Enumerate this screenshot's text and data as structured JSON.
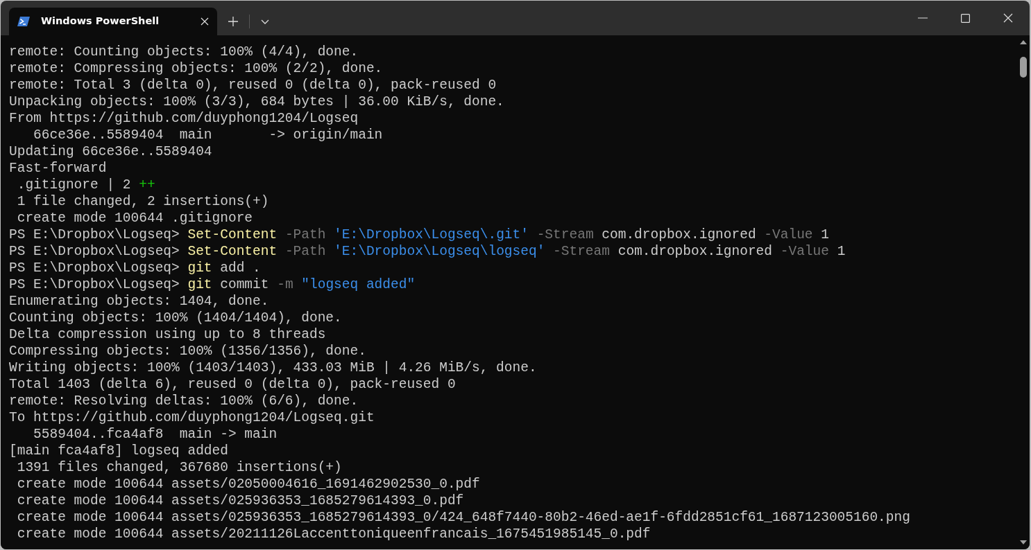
{
  "tabs": [
    {
      "label": "Windows PowerShell",
      "selected": true
    }
  ],
  "terminal": {
    "lines": [
      {
        "segments": [
          {
            "kind": "output",
            "text": "remote: Counting objects: 100% (4/4), done."
          }
        ]
      },
      {
        "segments": [
          {
            "kind": "output",
            "text": "remote: Compressing objects: 100% (2/2), done."
          }
        ]
      },
      {
        "segments": [
          {
            "kind": "output",
            "text": "remote: Total 3 (delta 0), reused 0 (delta 0), pack-reused 0"
          }
        ]
      },
      {
        "segments": [
          {
            "kind": "output",
            "text": "Unpacking objects: 100% (3/3), 684 bytes | 36.00 KiB/s, done."
          }
        ]
      },
      {
        "segments": [
          {
            "kind": "output",
            "text": "From https://github.com/duyphong1204/Logseq"
          }
        ]
      },
      {
        "segments": [
          {
            "kind": "output",
            "text": "   66ce36e..5589404  main       -> origin/main"
          }
        ]
      },
      {
        "segments": [
          {
            "kind": "output",
            "text": "Updating 66ce36e..5589404"
          }
        ]
      },
      {
        "segments": [
          {
            "kind": "output",
            "text": "Fast-forward"
          }
        ]
      },
      {
        "segments": [
          {
            "kind": "output",
            "text": " .gitignore | 2 "
          },
          {
            "kind": "added",
            "text": "++"
          }
        ]
      },
      {
        "segments": [
          {
            "kind": "output",
            "text": " 1 file changed, 2 insertions(+)"
          }
        ]
      },
      {
        "segments": [
          {
            "kind": "output",
            "text": " create mode 100644 .gitignore"
          }
        ]
      },
      {
        "segments": [
          {
            "kind": "output",
            "text": "PS E:\\Dropbox\\Logseq> "
          },
          {
            "kind": "command",
            "text": "Set-Content"
          },
          {
            "kind": "parameter",
            "text": " -Path "
          },
          {
            "kind": "string",
            "text": "'E:\\Dropbox\\Logseq\\.git'"
          },
          {
            "kind": "parameter",
            "text": " -Stream "
          },
          {
            "kind": "output",
            "text": "com.dropbox.ignored"
          },
          {
            "kind": "parameter",
            "text": " -Value "
          },
          {
            "kind": "output",
            "text": "1"
          }
        ]
      },
      {
        "segments": [
          {
            "kind": "output",
            "text": "PS E:\\Dropbox\\Logseq> "
          },
          {
            "kind": "command",
            "text": "Set-Content"
          },
          {
            "kind": "parameter",
            "text": " -Path "
          },
          {
            "kind": "string",
            "text": "'E:\\Dropbox\\Logseq\\logseq'"
          },
          {
            "kind": "parameter",
            "text": " -Stream "
          },
          {
            "kind": "output",
            "text": "com.dropbox.ignored"
          },
          {
            "kind": "parameter",
            "text": " -Value "
          },
          {
            "kind": "output",
            "text": "1"
          }
        ]
      },
      {
        "segments": [
          {
            "kind": "output",
            "text": "PS E:\\Dropbox\\Logseq> "
          },
          {
            "kind": "command",
            "text": "git"
          },
          {
            "kind": "output",
            "text": " add ."
          }
        ]
      },
      {
        "segments": [
          {
            "kind": "output",
            "text": "PS E:\\Dropbox\\Logseq> "
          },
          {
            "kind": "command",
            "text": "git"
          },
          {
            "kind": "output",
            "text": " commit "
          },
          {
            "kind": "parameter",
            "text": "-m "
          },
          {
            "kind": "string",
            "text": "\"logseq added\""
          }
        ]
      },
      {
        "segments": [
          {
            "kind": "output",
            "text": "Enumerating objects: 1404, done."
          }
        ]
      },
      {
        "segments": [
          {
            "kind": "output",
            "text": "Counting objects: 100% (1404/1404), done."
          }
        ]
      },
      {
        "segments": [
          {
            "kind": "output",
            "text": "Delta compression using up to 8 threads"
          }
        ]
      },
      {
        "segments": [
          {
            "kind": "output",
            "text": "Compressing objects: 100% (1356/1356), done."
          }
        ]
      },
      {
        "segments": [
          {
            "kind": "output",
            "text": "Writing objects: 100% (1403/1403), 433.03 MiB | 4.26 MiB/s, done."
          }
        ]
      },
      {
        "segments": [
          {
            "kind": "output",
            "text": "Total 1403 (delta 6), reused 0 (delta 0), pack-reused 0"
          }
        ]
      },
      {
        "segments": [
          {
            "kind": "output",
            "text": "remote: Resolving deltas: 100% (6/6), done."
          }
        ]
      },
      {
        "segments": [
          {
            "kind": "output",
            "text": "To https://github.com/duyphong1204/Logseq.git"
          }
        ]
      },
      {
        "segments": [
          {
            "kind": "output",
            "text": "   5589404..fca4af8  main -> main"
          }
        ]
      },
      {
        "segments": [
          {
            "kind": "output",
            "text": "[main fca4af8] logseq added"
          }
        ]
      },
      {
        "segments": [
          {
            "kind": "output",
            "text": " 1391 files changed, 367680 insertions(+)"
          }
        ]
      },
      {
        "segments": [
          {
            "kind": "output",
            "text": " create mode 100644 assets/02050004616_1691462902530_0.pdf"
          }
        ]
      },
      {
        "segments": [
          {
            "kind": "output",
            "text": " create mode 100644 assets/025936353_1685279614393_0.pdf"
          }
        ]
      },
      {
        "segments": [
          {
            "kind": "output",
            "text": " create mode 100644 assets/025936353_1685279614393_0/424_648f7440-80b2-46ed-ae1f-6fdd2851cf61_1687123005160.png"
          }
        ]
      },
      {
        "segments": [
          {
            "kind": "output",
            "text": " create mode 100644 assets/20211126Laccenttoniqueenfrancais_1675451985145_0.pdf"
          }
        ]
      }
    ]
  }
}
